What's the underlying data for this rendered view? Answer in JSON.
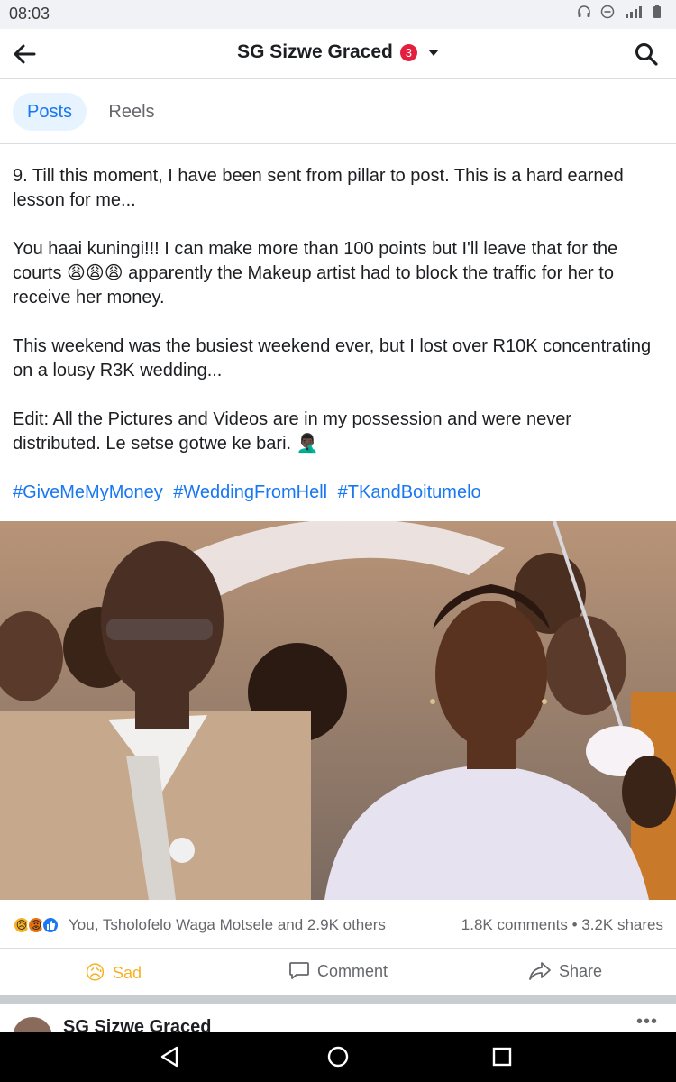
{
  "status_bar": {
    "time": "08:03"
  },
  "header": {
    "title": "SG Sizwe Graced",
    "badge_count": "3"
  },
  "tabs": [
    {
      "label": "Posts",
      "active": true
    },
    {
      "label": "Reels",
      "active": false
    }
  ],
  "post": {
    "paragraphs": [
      "9. Till this moment, I have been sent from pillar to post. This is a hard earned lesson for me...",
      "You haai kuningi!!! I can make more than 100 points but I'll leave that for the courts 😩😩😩 apparently the Makeup artist had to block the traffic for her to receive her money.",
      "This weekend was the busiest weekend ever, but I lost over R10K concentrating on a lousy R3K wedding...",
      "Edit: All the Pictures and Videos are in my possession and were never distributed. Le setse gotwe ke bari. 🤦🏿‍♂️"
    ],
    "hashtags": [
      "#GiveMeMyMoney",
      "#WeddingFromHell",
      "#TKandBoitumelo"
    ],
    "reaction_summary": "You, Tsholofelo Waga Motsele and 2.9K others",
    "counts": "1.8K comments • 3.2K shares",
    "actions": {
      "sad": "Sad",
      "comment": "Comment",
      "share": "Share"
    }
  },
  "next_post": {
    "author": "SG Sizwe Graced"
  },
  "colors": {
    "link": "#1877f2",
    "sad": "#f7b125",
    "tab_active_bg": "#e7f3ff"
  }
}
